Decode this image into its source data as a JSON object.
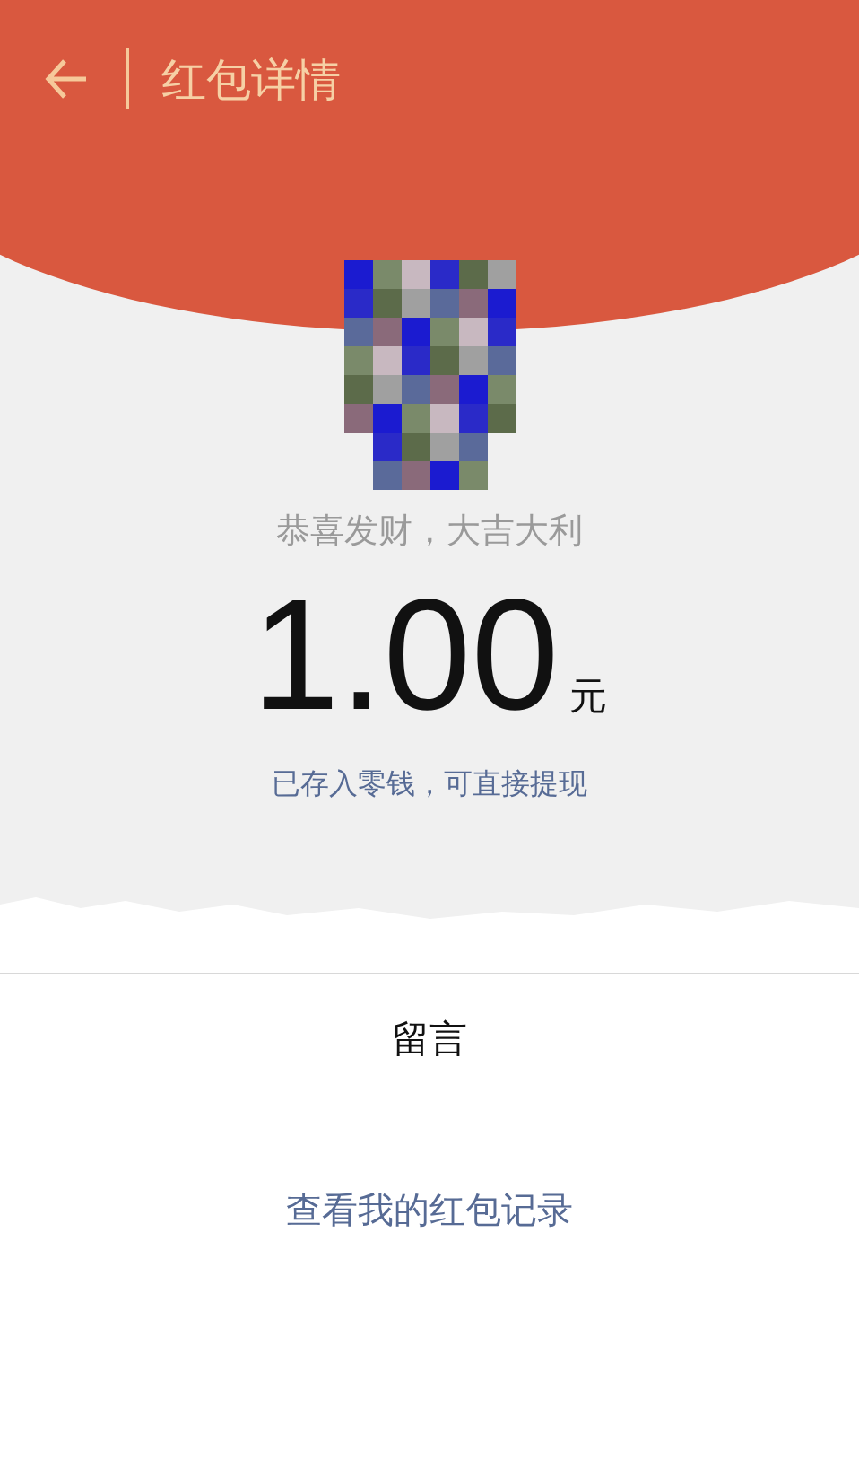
{
  "header": {
    "title": "红包详情"
  },
  "packet": {
    "greeting": "恭喜发财，大吉大利",
    "amount": "1.00",
    "unit": "元",
    "note": "已存入零钱，可直接提现"
  },
  "message": {
    "label": "留言"
  },
  "link": "查看我的红包记录"
}
